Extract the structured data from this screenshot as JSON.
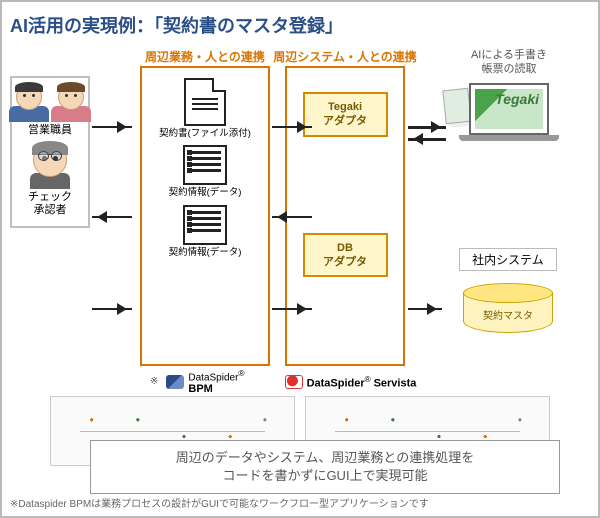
{
  "title": "AI活用の実現例：「契約書のマスタ登録」",
  "actors": {
    "sales": "営業職員",
    "checker": "チェック\n承認者"
  },
  "columns": {
    "col1": "周辺業務・人との連携",
    "col2": "周辺システム・人との連携"
  },
  "docs": {
    "doc1": "契約書(ファイル添付)",
    "doc2": "契約情報(データ)",
    "doc3": "契約情報(データ)"
  },
  "adapters": {
    "tegaki": "Tegaki\nアダプタ",
    "db": "DB\nアダプタ"
  },
  "ai_cloud": "AIによる手書き\n帳票の読取",
  "tegaki_logo": "Tegaki",
  "db_system": {
    "title": "社内システム",
    "label": "契約マスタ"
  },
  "brands": {
    "star": "※",
    "bpm_pre": "DataSpider",
    "bpm": "BPM",
    "sv_pre": "DataSpider",
    "sv": "Servista"
  },
  "caption": "周辺のデータやシステム、周辺業務との連携処理を\nコードを書かずにGUI上で実現可能",
  "footnote": "※Dataspider BPMは業務プロセスの設計がGUIで可能なワークフロー型アプリケーションです"
}
